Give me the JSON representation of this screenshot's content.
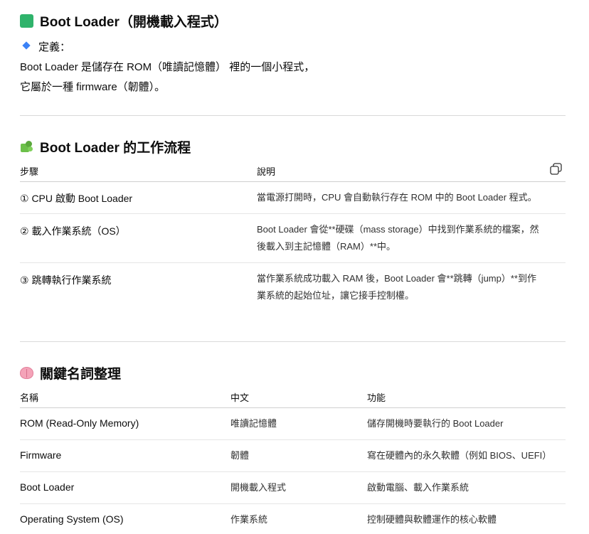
{
  "section1": {
    "title": "Boot Loader（開機載入程式）",
    "definition_label": "定義：",
    "line1": "Boot Loader 是儲存在 ROM（唯讀記憶體） 裡的一個小程式，",
    "line2": "它屬於一種 firmware（韌體）。"
  },
  "section2": {
    "title": "Boot Loader 的工作流程",
    "headers": [
      "步驟",
      "說明"
    ],
    "rows": [
      {
        "step": "① CPU 啟動 Boot Loader",
        "desc": [
          "當電源打開時，CPU 會自動執行存在 ROM 中的 Boot Loader 程式。"
        ]
      },
      {
        "step": "② 載入作業系統（OS）",
        "desc": [
          "Boot Loader 會從**硬碟（mass storage）中找到作業系統的檔案，然",
          "後載入到主記憶體（RAM）**中。"
        ]
      },
      {
        "step": "③ 跳轉執行作業系統",
        "desc": [
          "當作業系統成功載入 RAM 後，Boot Loader 會**跳轉（jump）**到作",
          "業系統的起始位址，讓它接手控制權。"
        ]
      }
    ]
  },
  "section3": {
    "title": "關鍵名詞整理",
    "headers": [
      "名稱",
      "中文",
      "功能"
    ],
    "rows": [
      [
        "ROM (Read-Only Memory)",
        "唯讀記憶體",
        "儲存開機時要執行的 Boot Loader"
      ],
      [
        "Firmware",
        "韌體",
        "寫在硬體內的永久軟體（例如 BIOS、UEFI）"
      ],
      [
        "Boot Loader",
        "開機載入程式",
        "啟動電腦、載入作業系統"
      ],
      [
        "Operating System (OS)",
        "作業系統",
        "控制硬體與軟體運作的核心軟體"
      ]
    ]
  },
  "icons": {
    "section1": "green-square-icon",
    "definition": "blue-diamond-icon",
    "section2": "puzzle-icon",
    "section3": "brain-icon",
    "copy": "copy-icon"
  }
}
